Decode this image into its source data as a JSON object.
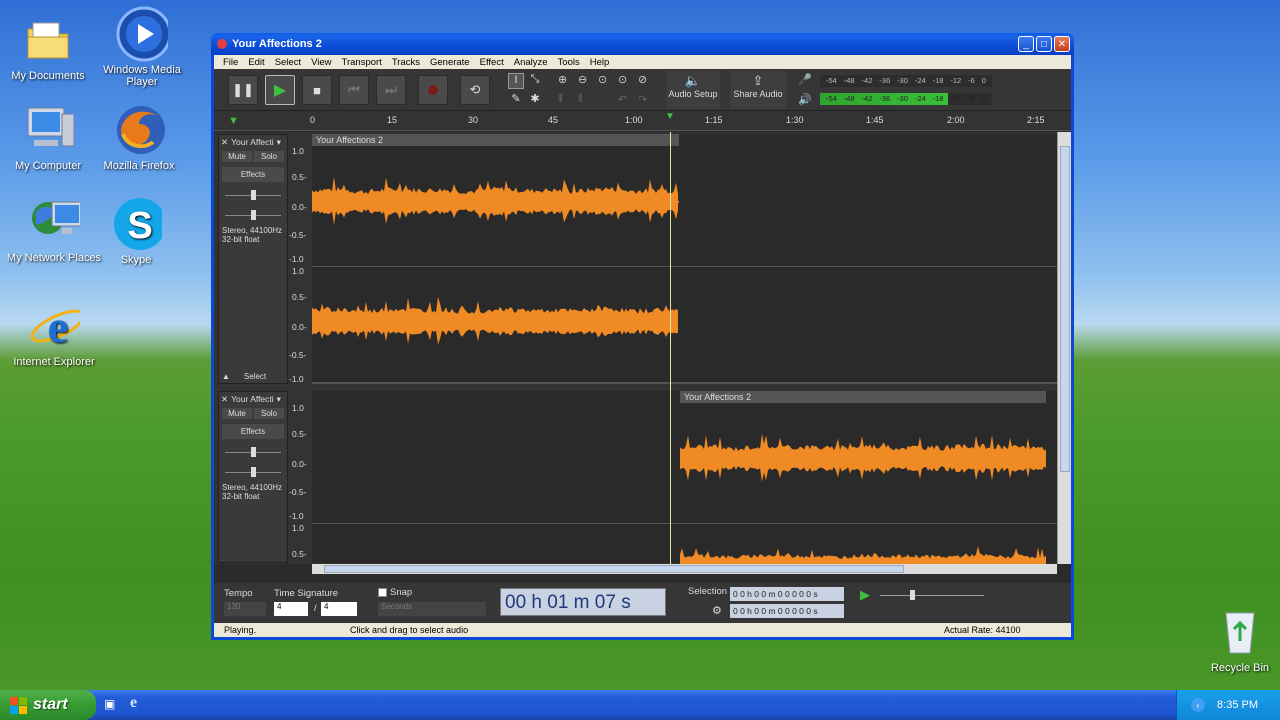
{
  "desktop": {
    "icons": [
      {
        "label": "My Documents"
      },
      {
        "label": "Windows Media Player"
      },
      {
        "label": "My Computer"
      },
      {
        "label": "Mozilla Firefox"
      },
      {
        "label": "My Network Places"
      },
      {
        "label": "Skype"
      },
      {
        "label": "Internet Explorer"
      },
      {
        "label": "Recycle Bin"
      }
    ]
  },
  "window": {
    "title": "Your Affections 2",
    "menu": [
      "File",
      "Edit",
      "Select",
      "View",
      "Transport",
      "Tracks",
      "Generate",
      "Effect",
      "Analyze",
      "Tools",
      "Help"
    ],
    "toolbar": {
      "audio_setup": "Audio Setup",
      "share_audio": "Share Audio",
      "meter_ticks": [
        "-54",
        "-48",
        "-42",
        "-36",
        "-30",
        "-24",
        "-18",
        "-12",
        "-6",
        "0"
      ],
      "meter_rec_label": "R",
      "meter_l": "L"
    },
    "ruler": [
      "0",
      "15",
      "30",
      "45",
      "1:00",
      "1:15",
      "1:30",
      "1:45",
      "2:00",
      "2:15"
    ],
    "tracks": [
      {
        "name": "Your Affecti",
        "mute": "Mute",
        "solo": "Solo",
        "effects": "Effects",
        "info1": "Stereo, 44100Hz",
        "info2": "32-bit float",
        "select": "Select",
        "clip": "Your Affections 2",
        "scale": [
          "1.0",
          "0.5-",
          "0.0-",
          "-0.5-",
          "-1.0",
          "1.0",
          "0.5-",
          "0.0-",
          "-0.5-",
          "-1.0"
        ]
      },
      {
        "name": "Your Affecti",
        "mute": "Mute",
        "solo": "Solo",
        "effects": "Effects",
        "info1": "Stereo, 44100Hz",
        "info2": "32-bit float",
        "clip": "Your Affections 2",
        "scale": [
          "1.0",
          "0.5-",
          "0.0-",
          "-0.5-",
          "-1.0",
          "1.0",
          "0.5-"
        ]
      }
    ],
    "bottom": {
      "tempo_label": "Tempo",
      "tempo_value": "120",
      "timesig_label": "Time Signature",
      "timesig_num": "4",
      "timesig_den": "4",
      "snap_label": "Snap",
      "snap_unit": "Seconds",
      "time_display": "00 h 01 m 07 s",
      "selection_label": "Selection",
      "sel_start": "0 0 h 0 0 m 0 0 0 0 0 s",
      "sel_end": "0 0 h 0 0 m 0 0 0 0 0 s"
    },
    "status": {
      "state": "Playing.",
      "hint": "Click and drag to select audio",
      "rate": "Actual Rate: 44100"
    }
  },
  "taskbar": {
    "start": "start",
    "time": "8:35 PM"
  },
  "colors": {
    "waveform": "#f08a24",
    "waveform_light": "#f7a64c",
    "xp_blue": "#245edb"
  }
}
